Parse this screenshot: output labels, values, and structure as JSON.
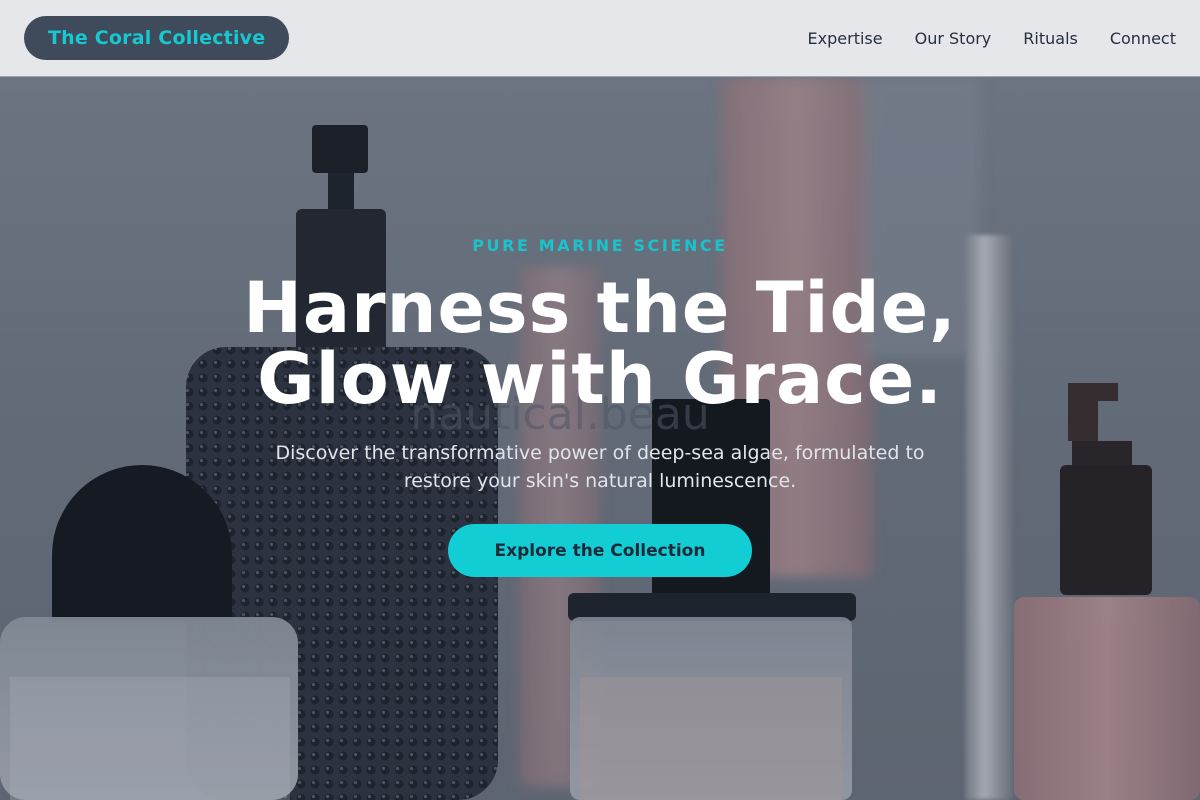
{
  "nav": {
    "brand": "The Coral Collective",
    "links": [
      "Expertise",
      "Our Story",
      "Rituals",
      "Connect"
    ]
  },
  "hero": {
    "background_image": "blurred-cosmetic-bottles-photo",
    "eyebrow": "PURE MARINE SCIENCE",
    "headline_line1": "Harness the Tide,",
    "headline_line2": "Glow with Grace.",
    "subtext": "Discover the transformative power of deep-sea algae, formulated to restore your skin's natural luminescence.",
    "cta_label": "Explore the Collection"
  },
  "colors": {
    "accent": "#12cdd4",
    "nav_bg": "#e5e7eb",
    "brand_pill": "#3f4a5a",
    "overlay": "#6b7380"
  }
}
